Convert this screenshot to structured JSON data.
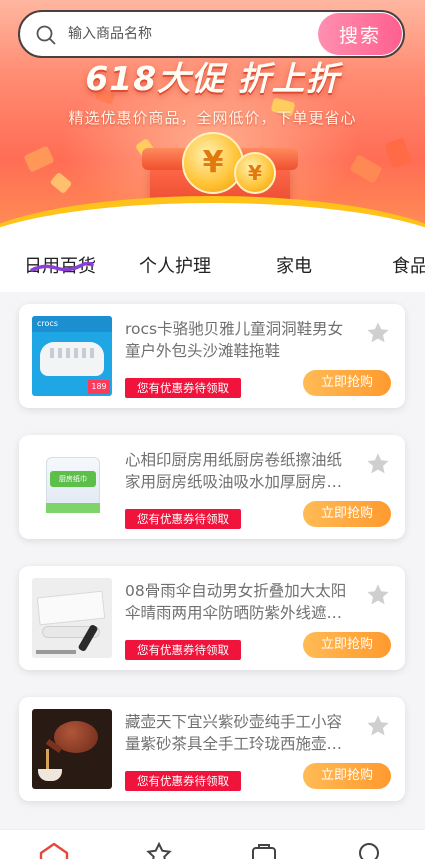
{
  "search": {
    "placeholder": "输入商品名称",
    "button_label": "搜索"
  },
  "banner": {
    "title": "618大促 折上折",
    "subtitle": "精选优惠价商品，全网低价，下单更省心"
  },
  "tabs": [
    {
      "label": "日用百货",
      "active": true
    },
    {
      "label": "个人护理",
      "active": false
    },
    {
      "label": "家电",
      "active": false
    },
    {
      "label": "食品",
      "active": false
    }
  ],
  "products": [
    {
      "title": "rocs卡骆驰贝雅儿童洞洞鞋男女童户外包头沙滩鞋拖鞋",
      "coupon_label": "您有优惠券待领取",
      "buy_label": "立即抢购",
      "thumb_brand": "crocs",
      "thumb_price": "189"
    },
    {
      "title": "心相印厨房用纸厨房卷纸擦油纸家用厨房纸吸油吸水加厚厨房专用纸",
      "coupon_label": "您有优惠券待领取",
      "buy_label": "立即抢购",
      "thumb_brand": "厨房纸巾"
    },
    {
      "title": "08骨雨伞自动男女折叠加大太阳伞晴雨两用伞防晒防紫外线遮阳伞",
      "coupon_label": "您有优惠券待领取",
      "buy_label": "立即抢购"
    },
    {
      "title": "藏壶天下宜兴紫砂壶纯手工小容量紫砂茶具全手工玲珑西施壶泡茶壶",
      "coupon_label": "您有优惠券待领取",
      "buy_label": "立即抢购"
    }
  ],
  "colors": {
    "accent": "#ff5f8e",
    "coupon": "#f0143c",
    "buy": "#ffa73c",
    "active_tab": "#e4483a"
  }
}
